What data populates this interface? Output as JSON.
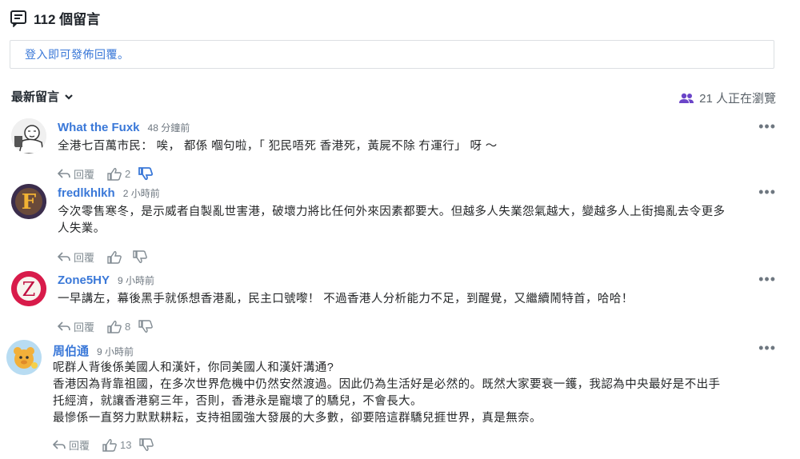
{
  "header": {
    "title": "112 個留言"
  },
  "login_prompt": "登入即可發佈回覆。",
  "sort": {
    "label": "最新留言"
  },
  "viewers": {
    "label": "21 人正在瀏覽"
  },
  "actions": {
    "reply_label": "回覆"
  },
  "comments": [
    {
      "author": "What the Fuxk",
      "time": "48 分鐘前",
      "lines": [
        "全港七百萬市民： 唉， 都係 嗰句啦，「 犯民唔死 香港死，黃屍不除 冇運行」 呀 ～"
      ],
      "likes": "2"
    },
    {
      "author": "fredlkhlkh",
      "time": "2 小時前",
      "lines": [
        "今次零售寒冬，是示威者自製亂世害港，破壞力將比任何外來因素都要大。但越多人失業怨氣越大，變越多人上街搗亂去令更多",
        "人失業。"
      ],
      "likes": ""
    },
    {
      "author": "Zone5HY",
      "time": "9 小時前",
      "lines": [
        "一早講左，幕後黑手就係想香港亂，民主口號嚟！ 不過香港人分析能力不足，到醒覺，又繼續鬧特首，哈哈！"
      ],
      "likes": "8"
    },
    {
      "author": "周伯通",
      "time": "9 小時前",
      "lines": [
        "呢群人背後係美國人和漢奸，你同美國人和漢奸溝通?",
        "香港因為背靠祖國，在多次世界危機中仍然安然渡過。因此仍為生活好是必然的。既然大家要衰一鑊，我認為中央最好是不出手",
        "托經濟，就讓香港窮三年，否則，香港永是寵壞了的驕兒，不會長大。",
        "最慘係一直努力默默耕耘，支持祖國強大發展的大多數，卻要陪這群驕兒捱世界，真是無奈。"
      ],
      "likes": "13"
    }
  ],
  "colors": {
    "link": "#3a78d8",
    "viewer_icon": "#6b45c8",
    "dislike_active": "#3a78d8"
  }
}
